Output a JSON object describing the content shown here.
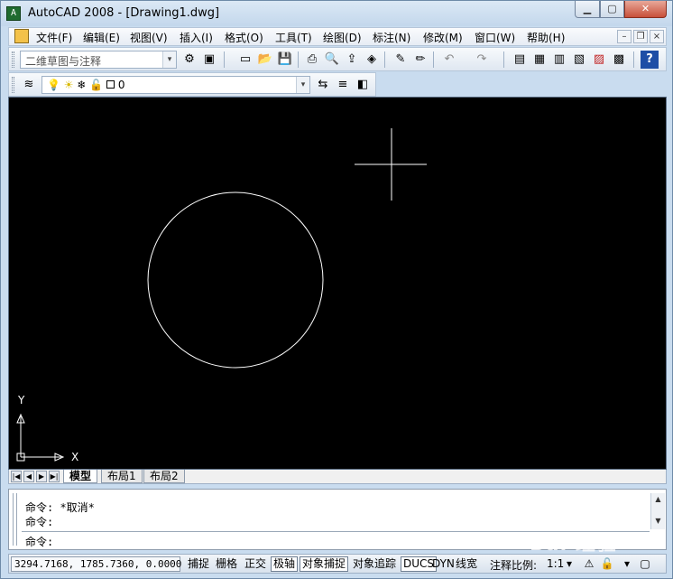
{
  "window": {
    "title": "AutoCAD 2008 - [Drawing1.dwg]",
    "minimize": "▁",
    "maximize": "▢",
    "close": "✕"
  },
  "menu": {
    "items": [
      "文件(F)",
      "编辑(E)",
      "视图(V)",
      "插入(I)",
      "格式(O)",
      "工具(T)",
      "绘图(D)",
      "标注(N)",
      "修改(M)",
      "窗口(W)",
      "帮助(H)"
    ],
    "mdi_minimize": "–",
    "mdi_restore": "❐",
    "mdi_close": "×"
  },
  "toolbar": {
    "workspace_value": "二维草图与注释",
    "layer_value": "0",
    "dropdown_arrow": "▾"
  },
  "icons": {
    "workspace_settings": "⚙",
    "workspace_save": "▣",
    "new_file": "▭",
    "open_file": "📂",
    "save_file": "💾",
    "print": "⎙",
    "preview": "🔍",
    "publish": "⇪",
    "3d_print": "◈",
    "match_prop": "✎",
    "block_editor": "✏",
    "undo": "↶",
    "redo": "↷",
    "properties": "▤",
    "design_center": "▦",
    "tool_palettes": "▥",
    "sheet_set": "▧",
    "markup": "▨",
    "calc": "▩",
    "help": "?",
    "layer_manager": "≋",
    "bulb": "💡",
    "sun": "☀",
    "freeze": "❄",
    "lock": "🔓",
    "layer_prev": "⇆",
    "layer_current": "≡",
    "layer_state": "◧"
  },
  "canvas": {
    "y_axis_label": "Y",
    "x_axis_label": "X"
  },
  "layout_tabs": {
    "nav": [
      "|◀",
      "◀",
      "▶",
      "▶|"
    ],
    "model": "模型",
    "layout1": "布局1",
    "layout2": "布局2"
  },
  "command": {
    "line1": "命令: *取消*",
    "line2": "命令:",
    "prompt": "命令:"
  },
  "status": {
    "coords": "3294.7168, 1785.7360, 0.0000",
    "toggles": [
      {
        "label": "捕捉",
        "on": false
      },
      {
        "label": "栅格",
        "on": false
      },
      {
        "label": "正交",
        "on": false
      },
      {
        "label": "极轴",
        "on": true
      },
      {
        "label": "对象捕捉",
        "on": true
      },
      {
        "label": "对象追踪",
        "on": false
      },
      {
        "label": "DUCS",
        "on": true
      },
      {
        "label": "DYN",
        "on": false
      },
      {
        "label": "线宽",
        "on": false
      }
    ],
    "annotation_scale_label": "注释比例:",
    "annotation_scale_value": "1:1",
    "annotation_arrow": "▾"
  },
  "watermark": "Bai 经验",
  "colors": {
    "canvas_bg": "#000000",
    "drawing_stroke": "#ffffff",
    "title_bar": "#c9dcef",
    "close_button": "#c8503a"
  }
}
